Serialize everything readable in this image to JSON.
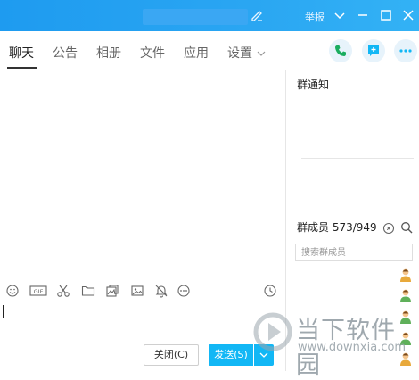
{
  "titlebar": {
    "report_label": "举报"
  },
  "tabs": [
    {
      "label": "聊天"
    },
    {
      "label": "公告"
    },
    {
      "label": "相册"
    },
    {
      "label": "文件"
    },
    {
      "label": "应用"
    },
    {
      "label": "设置"
    }
  ],
  "composer": {
    "close_label": "关闭(C)",
    "send_label": "发送(S)"
  },
  "sidebar": {
    "notice_title": "群通知",
    "members_label": "群成员 573/949",
    "search_placeholder": "搜索群成员"
  },
  "watermark": {
    "title": "当下软件园",
    "url": "www.downxia.com"
  },
  "colors": {
    "titlebar": "#1e9bf0",
    "accent": "#12b7f5",
    "icon_circle": "#e7f3fb"
  }
}
